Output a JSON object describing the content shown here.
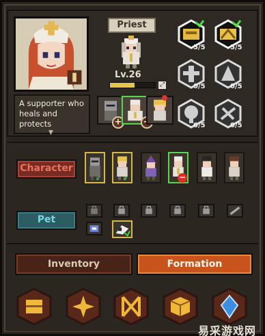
{
  "hero": {
    "class_name": "Priest",
    "level": "Lv.26",
    "xp_progress": 0.55,
    "description": "A supporter who heals and protects",
    "desc_more_icon": "▼"
  },
  "equip_slots": [
    {
      "icon": "knight-helmet",
      "plus": "+"
    },
    {
      "icon": "priest-hood",
      "selected": true,
      "plus": "+"
    },
    {
      "icon": "blonde-hero",
      "alert": true
    }
  ],
  "skills": [
    {
      "count": "5/5",
      "icon": "gold-skill-1"
    },
    {
      "count": "5/5",
      "icon": "gold-skill-2"
    },
    {
      "count": "0/5",
      "icon": "locked-skill-1"
    },
    {
      "count": "0/5",
      "icon": "locked-skill-2"
    },
    {
      "count": "0/5",
      "icon": "locked-skill-3"
    },
    {
      "count": "0/5",
      "icon": "locked-skill-4"
    }
  ],
  "tabs": {
    "character": "Character",
    "pet": "Pet"
  },
  "bottom_tabs": {
    "inventory": "Inventory",
    "formation": "Formation"
  },
  "watermark": "易采游戏网",
  "xp_icon_glyph": "⤢",
  "icons": {
    "check": "✓",
    "minus": "−",
    "chest": "chest-icon",
    "cross": "cross-icon",
    "rune": "rune-icon",
    "box": "box-icon",
    "gem": "gem-icon"
  },
  "colors": {
    "selected_border": "#55d84b",
    "gold_border": "#d9b84a",
    "alert": "#e2332e",
    "formation_tab": "#c8531d"
  }
}
